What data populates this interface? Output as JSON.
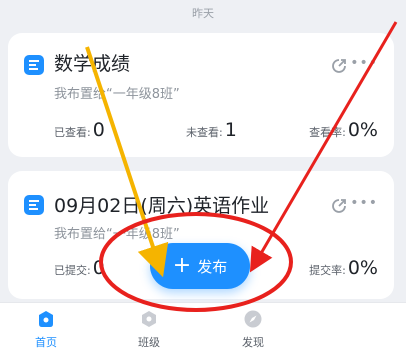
{
  "date_header": "昨天",
  "cards": [
    {
      "title": "数学成绩",
      "subtitle": "我布置给“一年级8班”",
      "stats": [
        {
          "label": "已查看:",
          "value": "0"
        },
        {
          "label": "未查看:",
          "value": "1"
        },
        {
          "label": "查看率:",
          "value": "0%"
        }
      ]
    },
    {
      "title": "09月02日(周六)英语作业",
      "subtitle": "我布置给“一年级8班”",
      "stats": [
        {
          "label": "已提交:",
          "value": "0"
        },
        {
          "label": "",
          "value": ""
        },
        {
          "label": "提交率:",
          "value": "0%"
        }
      ]
    }
  ],
  "fab": {
    "label": "发布",
    "icon": "plus-icon"
  },
  "tabs": [
    {
      "label": "首页",
      "icon": "home-icon",
      "active": true
    },
    {
      "label": "班级",
      "icon": "class-icon",
      "active": false
    },
    {
      "label": "发现",
      "icon": "discover-icon",
      "active": false
    }
  ],
  "colors": {
    "accent": "#1e90ff",
    "annotation_red": "#e8211d",
    "annotation_yellow": "#f5b400"
  }
}
